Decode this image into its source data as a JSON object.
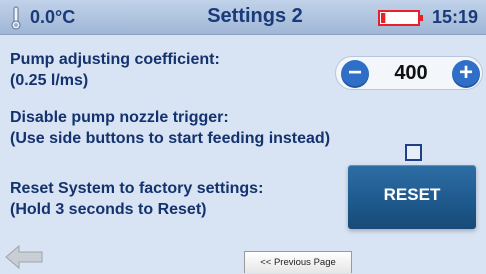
{
  "status_bar": {
    "temperature": "0.0°C",
    "title": "Settings 2",
    "time": "15:19",
    "battery_level": 0.12,
    "battery_color": "#e8202a"
  },
  "pump_coefficient": {
    "label_line1": "Pump adjusting coefficient:",
    "label_line2": "(0.25 l/ms)",
    "value": "400",
    "minus_symbol": "−",
    "plus_symbol": "+"
  },
  "nozzle_trigger": {
    "label_line1": "Disable pump nozzle trigger:",
    "label_line2": "(Use side buttons to start feeding instead)",
    "checked": false
  },
  "reset": {
    "label_line1": "Reset System to factory settings:",
    "label_line2": "(Hold 3 seconds to Reset)",
    "button_label": "RESET"
  },
  "navigation": {
    "previous_page_label": "<< Previous Page"
  },
  "icons": {
    "thermometer": "thermometer-icon",
    "battery": "battery-icon",
    "back": "back-arrow-icon"
  },
  "colors": {
    "accent": "#2f6fc8",
    "text": "#14336e",
    "reset_button": "#1f5a8e",
    "background": "#d8e3f3"
  }
}
